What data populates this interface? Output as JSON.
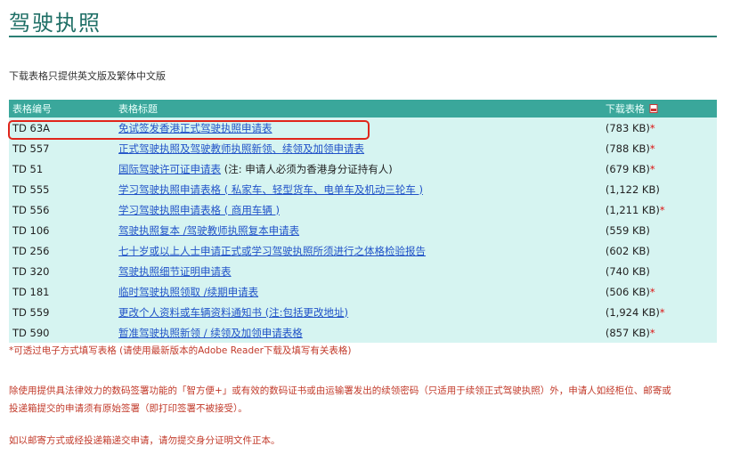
{
  "page": {
    "title": "驾驶执照",
    "notice": "下载表格只提供英文版及繁体中文版"
  },
  "table": {
    "headers": [
      "表格编号",
      "表格标题",
      "下载表格"
    ],
    "rows": [
      {
        "code": "TD 63A",
        "title": "免试签发香港正式驾驶执照申请表",
        "note": "",
        "size": "(783 KB)",
        "star": "*"
      },
      {
        "code": "TD 557",
        "title": "正式驾驶执照及驾驶教师执照新领、续领及加领申请表",
        "note": "",
        "size": "(788 KB)",
        "star": "*"
      },
      {
        "code": "TD 51",
        "title": "国际驾驶许可证申请表",
        "note": " (注: 申请人必须为香港身分证持有人)",
        "size": "(679 KB)",
        "star": "*"
      },
      {
        "code": "TD 555",
        "title": "学习驾驶执照申请表格 ( 私家车、轻型货车、电单车及机动三轮车 )",
        "note": "",
        "size": "(1,122 KB)",
        "star": ""
      },
      {
        "code": "TD 556",
        "title": "学习驾驶执照申请表格 ( 商用车辆 )",
        "note": "",
        "size": "(1,211 KB)",
        "star": "*"
      },
      {
        "code": "TD 106",
        "title": "驾驶执照复本 /驾驶教师执照复本申请表",
        "note": "",
        "size": "(559 KB)",
        "star": ""
      },
      {
        "code": "TD 256",
        "title": "七十岁或以上人士申请正式或学习驾驶执照所须进行之体格检验报告",
        "note": "",
        "size": "(602 KB)",
        "star": ""
      },
      {
        "code": "TD 320",
        "title": "驾驶执照细节证明申请表",
        "note": "",
        "size": "(740 KB)",
        "star": ""
      },
      {
        "code": "TD 181",
        "title": "临时驾驶执照领取 /续期申请表",
        "note": "",
        "size": "(506 KB)",
        "star": "*"
      },
      {
        "code": "TD 559",
        "title": "更改个人资料或车辆资料通知书 (注:包括更改地址)",
        "note": "",
        "size": "(1,924 KB)",
        "star": "*"
      },
      {
        "code": "TD 590",
        "title": "暂准驾驶执照新领 / 续领及加领申请表格",
        "note": "",
        "size": "(857 KB)",
        "star": "*"
      }
    ]
  },
  "notes": {
    "electronic": "*可透过电子方式填写表格 (请使用最新版本的Adobe Reader下载及填写有关表格)",
    "signature_1": "除使用提供具法律效力的数码签署功能的「智方便+」或有效的数码证书或由运输署发出的续领密码（只适用于续领正式驾驶执照）外，申请人如经柜位、邮寄或",
    "signature_2": "投递箱提交的申请须有原始签署（即打印签署不被接受）。",
    "mail": "如以邮寄方式或经投递箱递交申请，请勿提交身分证明文件正本。"
  },
  "colors": {
    "accent": "#1f6f66",
    "header": "#3aa79b",
    "row": "#d6f4f1",
    "link": "#2052c8",
    "highlight": "#e0251b",
    "note_red": "#c23a2a"
  }
}
